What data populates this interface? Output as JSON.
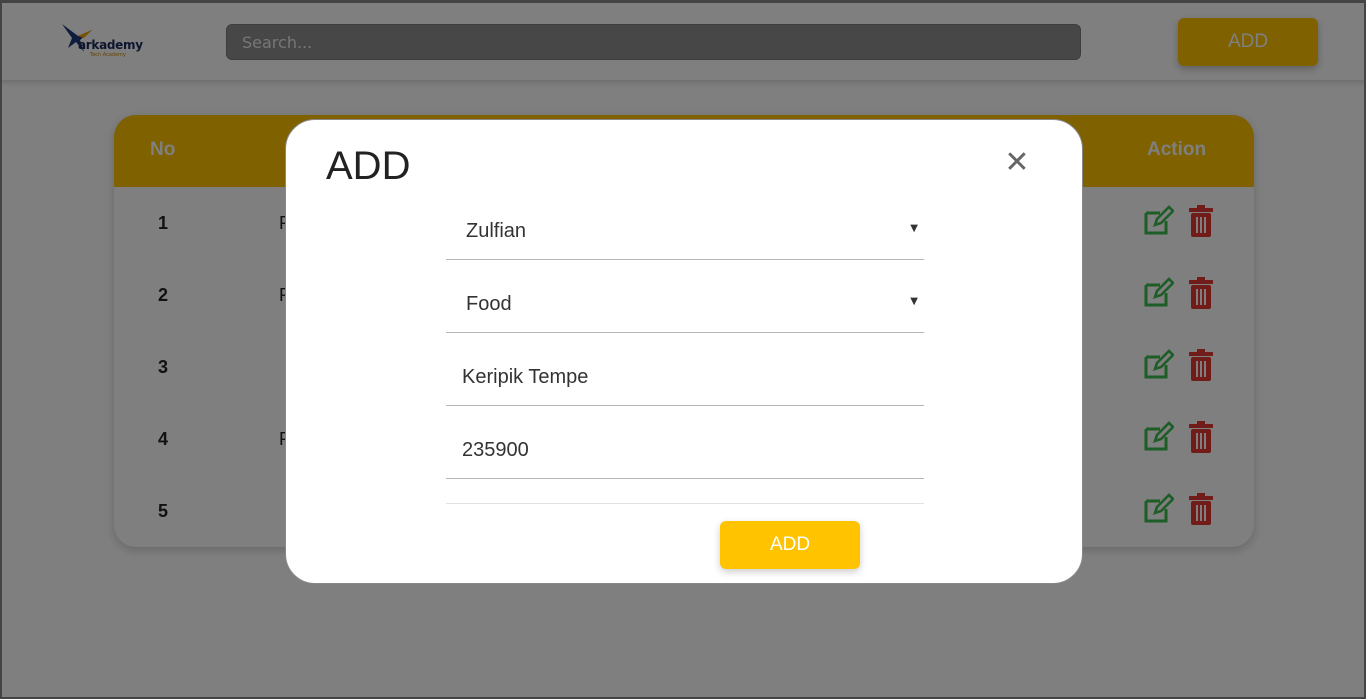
{
  "navbar": {
    "logo_text": "arkademy",
    "logo_sub": "Tech Academy",
    "search_placeholder": "Search...",
    "add_label": "ADD"
  },
  "table": {
    "headers": {
      "no": "No",
      "action": "Action"
    },
    "rows": [
      {
        "no": "1",
        "name_partial": "P"
      },
      {
        "no": "2",
        "name_partial": "R"
      },
      {
        "no": "3",
        "name_partial": ""
      },
      {
        "no": "4",
        "name_partial": "P"
      },
      {
        "no": "5",
        "name_partial": ""
      }
    ]
  },
  "modal": {
    "title": "ADD",
    "close_glyph": "✕",
    "fields": {
      "cashier": "Zulfian",
      "category": "Food",
      "name": "Keripik Tempe",
      "price": "235900"
    },
    "caret": "▼",
    "submit_label": "ADD"
  },
  "colors": {
    "accent": "#ffc300",
    "edit": "#3cbd4c",
    "delete": "#e53935"
  },
  "icons": {
    "edit": "edit-icon",
    "delete": "trash-icon",
    "close": "close-icon"
  }
}
